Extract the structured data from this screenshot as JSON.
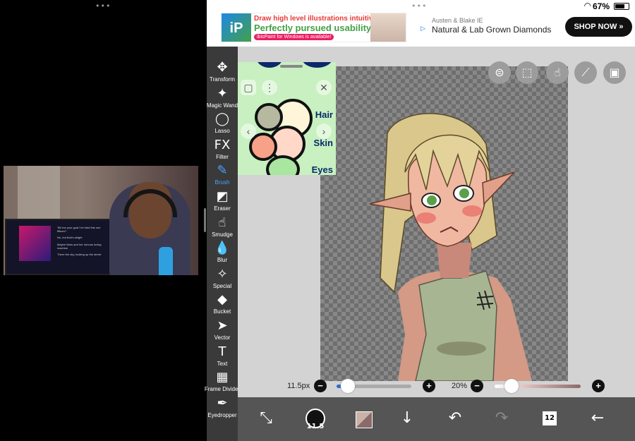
{
  "left": {
    "video": {
      "lyrics": [
        "Tell me your goal I've tried this one fifteen?",
        "No, but that's alright",
        "Maybe Mars and her ruinous loving machine",
        "There the sky, looking up the street"
      ]
    }
  },
  "status": {
    "battery": "67%"
  },
  "ads": {
    "ibis": {
      "logo": "iP",
      "line1": "Draw high level illustrations intuitively!",
      "line2": "Perfectly pursued usability!",
      "line3": "ibisPaint for Windows is available!"
    },
    "jeweler": {
      "sponsor": "Austen & Blake IE",
      "headline": "Natural & Lab Grown Diamonds",
      "cta": "SHOP NOW »"
    }
  },
  "toolbar": {
    "tools": [
      {
        "label": "Transform",
        "icon": "move-icon",
        "glyph": "✥"
      },
      {
        "label": "Magic Wand",
        "icon": "magic-wand-icon",
        "glyph": "✦"
      },
      {
        "label": "Lasso",
        "icon": "lasso-icon",
        "glyph": "◯"
      },
      {
        "label": "Filter",
        "icon": "filter-icon",
        "glyph": "FX"
      },
      {
        "label": "Brush",
        "icon": "brush-icon",
        "glyph": "✎",
        "active": true
      },
      {
        "label": "Eraser",
        "icon": "eraser-icon",
        "glyph": "◩"
      },
      {
        "label": "Smudge",
        "icon": "smudge-icon",
        "glyph": "☝"
      },
      {
        "label": "Blur",
        "icon": "blur-icon",
        "glyph": "💧"
      },
      {
        "label": "Special",
        "icon": "special-icon",
        "glyph": "✧"
      },
      {
        "label": "Bucket",
        "icon": "bucket-icon",
        "glyph": "◆"
      },
      {
        "label": "Vector",
        "icon": "vector-icon",
        "glyph": "➤"
      },
      {
        "label": "Text",
        "icon": "text-icon",
        "glyph": "T"
      },
      {
        "label": "Frame Divider",
        "icon": "frame-divider-icon",
        "glyph": "▦"
      },
      {
        "label": "Eyedropper",
        "icon": "eyedropper-icon",
        "glyph": "✒"
      }
    ]
  },
  "reference": {
    "labels": [
      "Hair",
      "Skin",
      "Eyes"
    ]
  },
  "sliders": {
    "brush_size": "11.5px",
    "brush_size_fraction": 0.15,
    "opacity": "20%",
    "opacity_fraction": 0.2
  },
  "bottombar": {
    "brush_size_badge": "11.5",
    "layer_count": "12"
  },
  "colors": {
    "toolbar_bg": "#3a3a3a",
    "active_tool": "#4aa3ff",
    "bottombar_bg": "#555555"
  }
}
